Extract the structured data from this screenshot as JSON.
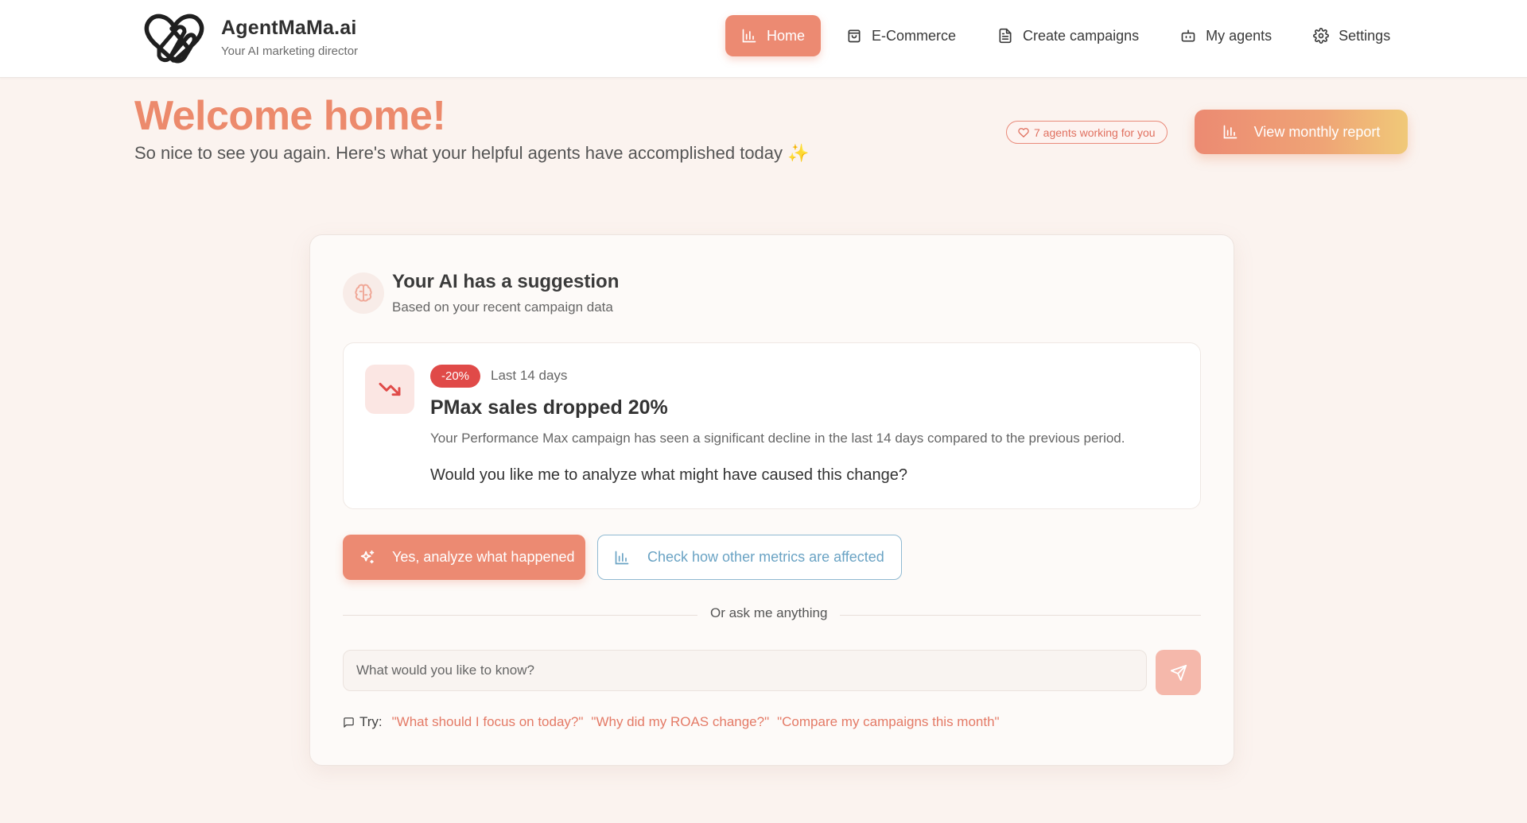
{
  "brand": {
    "name": "AgentMaMa.ai",
    "tagline": "Your AI marketing director"
  },
  "nav": {
    "items": [
      {
        "label": "Home",
        "icon": "bar-chart-icon",
        "active": true
      },
      {
        "label": "E-Commerce",
        "icon": "shopping-bag-icon",
        "active": false
      },
      {
        "label": "Create campaigns",
        "icon": "document-icon",
        "active": false
      },
      {
        "label": "My agents",
        "icon": "bot-icon",
        "active": false
      },
      {
        "label": "Settings",
        "icon": "gear-icon",
        "active": false
      }
    ]
  },
  "welcome": {
    "title": "Welcome home!",
    "subtitle": "So nice to see you again. Here's what your helpful agents have accomplished today ✨",
    "agents_badge": "7 agents working for you",
    "report_button": "View monthly report"
  },
  "suggestion": {
    "title": "Your AI has a suggestion",
    "subtitle": "Based on your recent campaign data",
    "alert": {
      "badge": "-20%",
      "period": "Last 14 days",
      "title": "PMax sales dropped 20%",
      "description": "Your Performance Max campaign has seen a significant decline in the last 14 days compared to the previous period.",
      "question": "Would you like me to analyze what might have caused this change?"
    },
    "primary_action": "Yes, analyze what happened",
    "secondary_action": "Check how other metrics are affected",
    "divider_label": "Or ask me anything",
    "ask_placeholder": "What would you like to know?",
    "try_label": "Try:",
    "try_examples": [
      "\"What should I focus on today?\"",
      "\"Why did my ROAS change?\"",
      "\"Compare my campaigns this month\""
    ]
  },
  "colors": {
    "accent": "#ec8a72",
    "title": "#ec8a6c",
    "danger": "#e04a48",
    "secondary": "#6aa3c4",
    "background": "#fbf3ef"
  }
}
